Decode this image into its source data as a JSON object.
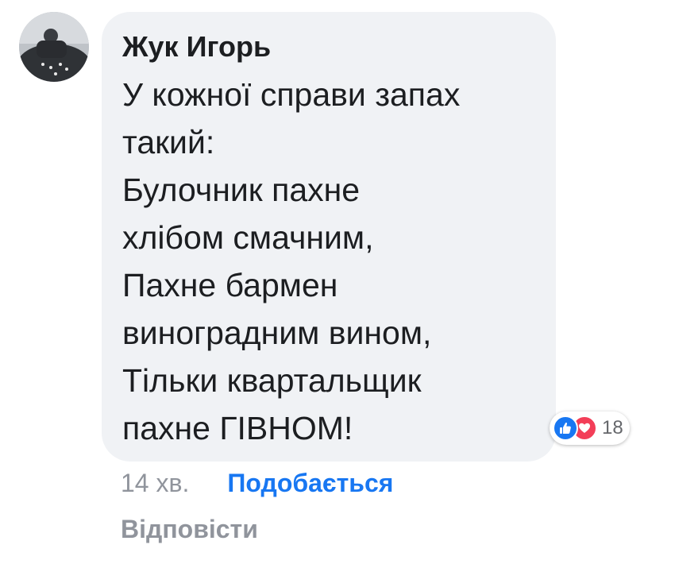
{
  "comment": {
    "author": "Жук Игорь",
    "lines": [
      "У кожної справи запах",
      "такий:",
      "Булочник пахне",
      "хлібом смачним,",
      "Пахне бармен",
      "виноградним вином,",
      "Тільки квартальщик",
      "пахне ГІВНОМ!"
    ]
  },
  "reactions": {
    "icons": [
      "thumbs-up-icon",
      "heart-icon"
    ],
    "count": "18"
  },
  "meta": {
    "time": "14 хв.",
    "like_label": "Подобається",
    "reply_label": "Відповісти"
  },
  "colors": {
    "bubble": "#f0f2f5",
    "accent": "#1877f2",
    "love": "#f33e58",
    "muted": "#90949c",
    "text": "#1c1e21"
  }
}
